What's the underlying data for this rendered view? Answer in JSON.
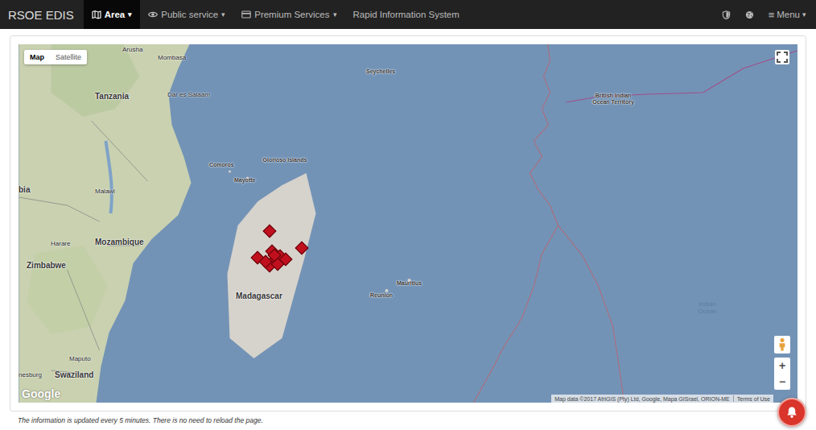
{
  "navbar": {
    "brand": "RSOE EDIS",
    "items": [
      {
        "label": "Area",
        "icon": "map",
        "caret": "▾",
        "selected": true
      },
      {
        "label": "Public service",
        "icon": "eye",
        "caret": "▾",
        "selected": false
      },
      {
        "label": "Premium Services",
        "icon": "card",
        "caret": "▾",
        "selected": false
      },
      {
        "label": "Rapid Information System",
        "icon": "none",
        "caret": "",
        "selected": false
      }
    ],
    "right_icons": [
      "shield",
      "globe"
    ],
    "menu": {
      "icon": "≡",
      "label": "Menu",
      "caret": "▾"
    }
  },
  "map": {
    "type_toggle": [
      {
        "label": "Map",
        "selected": true
      },
      {
        "label": "Satellite",
        "selected": false
      }
    ],
    "labels": [
      {
        "text": "Arusha",
        "kind": "city"
      },
      {
        "text": "Mombasa",
        "kind": "city"
      },
      {
        "text": "Tanzania",
        "kind": "country"
      },
      {
        "text": "Dar es Salaam",
        "kind": "city"
      },
      {
        "text": "Seychelles",
        "kind": "island"
      },
      {
        "text": "British Indian Ocean Territory",
        "kind": "territory"
      },
      {
        "text": "Comoros",
        "kind": "island"
      },
      {
        "text": "Glorioso Islands",
        "kind": "territory"
      },
      {
        "text": "Mayotte",
        "kind": "island"
      },
      {
        "text": "Malawi",
        "kind": "city"
      },
      {
        "text": "bia",
        "kind": "country"
      },
      {
        "text": "Harare",
        "kind": "city"
      },
      {
        "text": "Mozambique",
        "kind": "country"
      },
      {
        "text": "Zimbabwe",
        "kind": "country"
      },
      {
        "text": "Madagascar",
        "kind": "country"
      },
      {
        "text": "Mauritius",
        "kind": "island"
      },
      {
        "text": "Reunion",
        "kind": "island"
      },
      {
        "text": "Maputo",
        "kind": "city"
      },
      {
        "text": "Swaziland",
        "kind": "country"
      },
      {
        "text": "nesburg",
        "kind": "city"
      },
      {
        "text": "Indian Ocean",
        "kind": "ocean"
      }
    ],
    "markers": [
      {
        "kind": "diamond"
      },
      {
        "kind": "diamond"
      },
      {
        "kind": "diamond"
      },
      {
        "kind": "diamond"
      },
      {
        "kind": "diamond"
      },
      {
        "kind": "diamond"
      },
      {
        "kind": "diamond"
      },
      {
        "kind": "diamond"
      },
      {
        "kind": "diamond"
      },
      {
        "kind": "diamond"
      },
      {
        "kind": "diamond"
      }
    ],
    "zoom": [
      "+",
      "−"
    ],
    "logo": "Google",
    "attribution": "Map data ©2017 AfriGIS (Pty) Ltd, Google, Mapa GISrael, ORION-ME",
    "terms": "Terms of Use"
  },
  "footer": {
    "note": "The information is updated every 5 minutes. There is no need to reload the page."
  }
}
